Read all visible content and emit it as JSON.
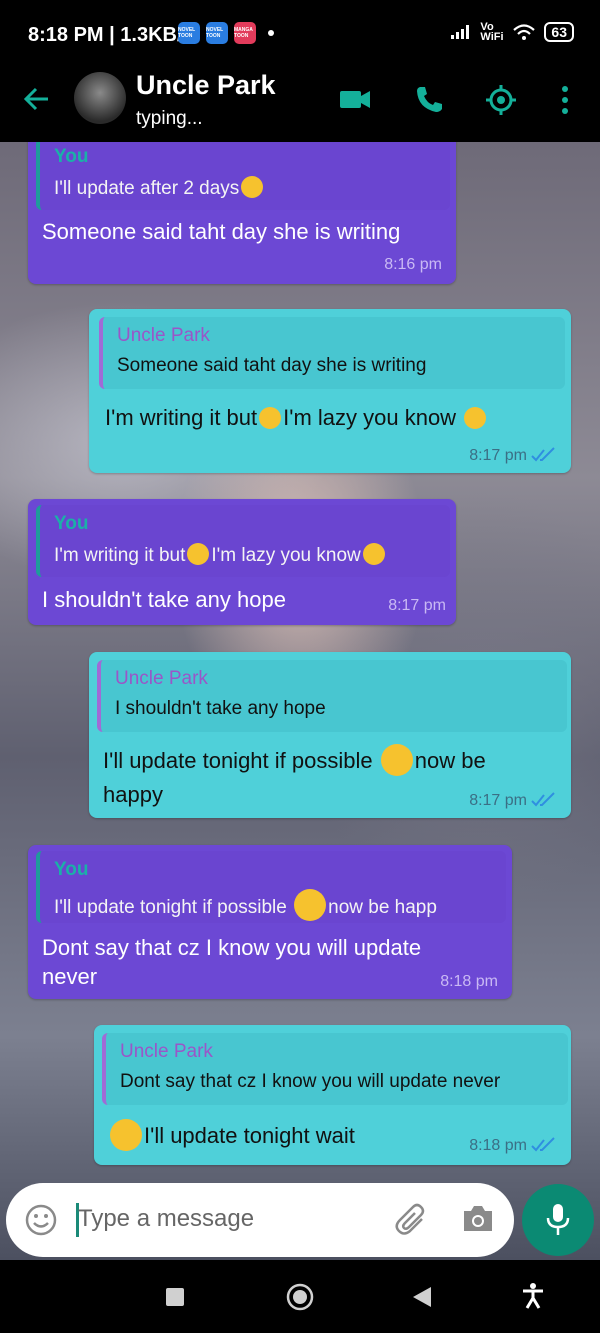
{
  "status_bar": {
    "time_speed": "8:18 PM | 1.3KB/s",
    "apps": [
      {
        "label": "NOVEL TOON",
        "color": "#2a7de1"
      },
      {
        "label": "NOVEL TOON",
        "color": "#2a7de1"
      },
      {
        "label": "MANGA TOON",
        "color": "#e23b5b"
      }
    ],
    "network": "Vo WiFi",
    "battery": "63"
  },
  "header": {
    "contact_name": "Uncle Park",
    "status": "typing...",
    "icons": [
      "back-arrow-icon",
      "video-call-icon",
      "voice-call-icon",
      "location-icon",
      "more-options-icon"
    ]
  },
  "messages": [
    {
      "direction": "incoming",
      "quote_author": "You",
      "quote_text": "I'll update after 2 days",
      "text": "Someone said taht day she is writing",
      "time": "8:16 pm"
    },
    {
      "direction": "outgoing",
      "quote_author": "Uncle Park",
      "quote_text": "Someone said taht day she is writing",
      "text_a": "I'm writing it but",
      "text_b": "I'm lazy you know",
      "time": "8:17 pm"
    },
    {
      "direction": "incoming",
      "quote_author": "You",
      "quote_text_a": "I'm writing it but",
      "quote_text_b": "I'm lazy you know",
      "text": "I shouldn't take any hope",
      "time": "8:17 pm"
    },
    {
      "direction": "outgoing",
      "quote_author": "Uncle Park",
      "quote_text": "I shouldn't take any hope",
      "text_a": "I'll update tonight if possible",
      "text_b": "now be",
      "text_c": "happy",
      "time": "8:17 pm"
    },
    {
      "direction": "incoming",
      "quote_author": "You",
      "quote_text_a": "I'll update tonight if possible",
      "quote_text_b": "now be happ",
      "text_a": "Dont say that cz I know you will update",
      "text_b": "never",
      "time": "8:18 pm"
    },
    {
      "direction": "outgoing",
      "quote_author": "Uncle Park",
      "quote_text": "Dont say that cz I know you will update never",
      "text": "I'll update tonight wait",
      "time": "8:18 pm"
    }
  ],
  "composer": {
    "placeholder": "Type a message",
    "icons": [
      "emoji-icon",
      "attach-icon",
      "camera-icon",
      "mic-icon"
    ]
  },
  "colors": {
    "incoming_bubble": "#6c48d4",
    "outgoing_bubble": "#4fd0d9",
    "accent": "#0b8a73",
    "read_ticks": "#2f8fe0"
  }
}
